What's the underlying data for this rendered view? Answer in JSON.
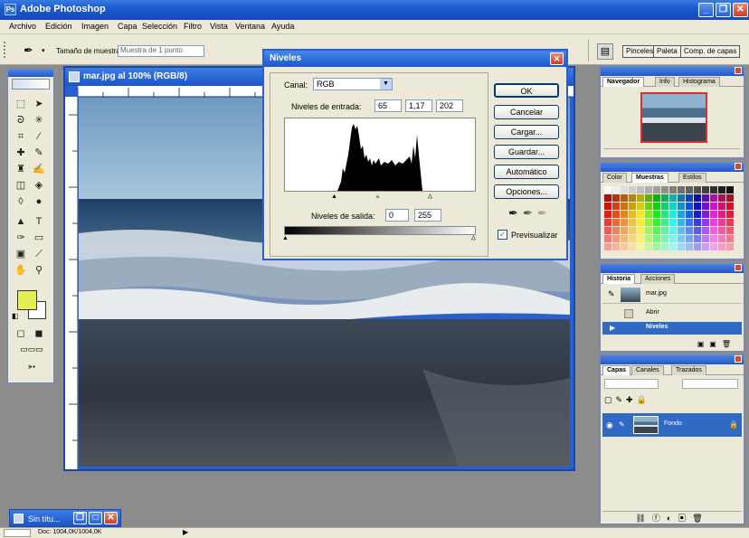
{
  "app": {
    "title": "Adobe Photoshop"
  },
  "menu": [
    "Archivo",
    "Edición",
    "Imagen",
    "Capa",
    "Selección",
    "Filtro",
    "Vista",
    "Ventana",
    "Ayuda"
  ],
  "options": {
    "sample_label": "Tamaño de muestra:",
    "sample_value": "Muestra de 1 punto"
  },
  "workspace_tabs": [
    "Pinceles",
    "Paleta",
    "Comp. de capas"
  ],
  "document": {
    "title": "mar.jpg al 100% (RGB/8)"
  },
  "levels": {
    "title": "Niveles",
    "channel_label": "Canal:",
    "channel_value": "RGB",
    "input_label": "Niveles de entrada:",
    "input_black": "65",
    "input_gamma": "1,17",
    "input_white": "202",
    "output_label": "Niveles de salida:",
    "output_black": "0",
    "output_white": "255",
    "buttons": {
      "ok": "OK",
      "cancel": "Cancelar",
      "load": "Cargar...",
      "save": "Guardar...",
      "auto": "Automático",
      "options": "Opciones..."
    },
    "preview_label": "Previsualizar",
    "preview_checked": true
  },
  "navigator": {
    "tabs": [
      "Navegador",
      "Info",
      "Histograma"
    ]
  },
  "swatches": {
    "tabs": [
      "Color",
      "Muestras",
      "Estilos"
    ]
  },
  "history": {
    "tabs": [
      "Historia",
      "Acciones"
    ],
    "items": [
      "mar.jpg",
      "Abrir",
      "Niveles"
    ]
  },
  "layers": {
    "tabs": [
      "Capas",
      "Canales",
      "Trazados"
    ],
    "layer_name": "Fondo"
  },
  "taskbar": {
    "min_window": "Sin títu..."
  },
  "status": {
    "doc_info": "Doc: 1004,0K/1004,0K"
  }
}
